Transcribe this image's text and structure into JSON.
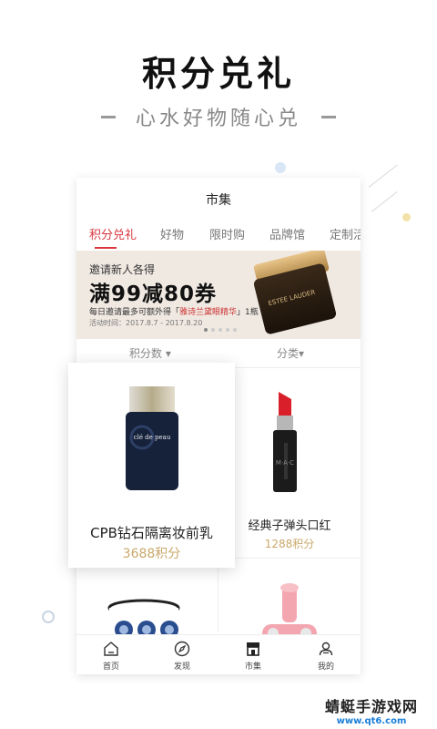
{
  "hero": {
    "title": "积分兑礼",
    "subtitle": "心水好物随心兑"
  },
  "app": {
    "page_title": "市集",
    "tabs": [
      {
        "label": "积分兑礼",
        "active": true
      },
      {
        "label": "好物"
      },
      {
        "label": "限时购"
      },
      {
        "label": "品牌馆"
      },
      {
        "label": "定制活"
      }
    ],
    "banner": {
      "line1": "邀请新人各得",
      "line2": "满99减80券",
      "line3_prefix": "每日邀请最多可额外得「",
      "line3_highlight": "雅诗兰黛眼精华",
      "line3_suffix": "」1瓶",
      "line4": "活动时间：2017.8.7 - 2017.8.20",
      "product_label": "ESTEE LAUDER",
      "page_dots": 5,
      "active_dot": 0
    },
    "filters": {
      "points": "积分数",
      "category": "分类"
    },
    "products": [
      {
        "name": "CPB钻石隔离妆前乳",
        "points": "3688积分",
        "image": "cpb-primer-bottle",
        "bottle_text": "clé de peau"
      },
      {
        "name": "经典子弹头口红",
        "points": "1288积分",
        "image": "mac-lipstick"
      },
      {
        "name": "",
        "points": "",
        "image": "blue-pattern-cup"
      },
      {
        "name": "",
        "points": "",
        "image": "pink-toy"
      }
    ],
    "bottom_nav": [
      {
        "label": "首页",
        "icon": "home-icon"
      },
      {
        "label": "发现",
        "icon": "compass-icon"
      },
      {
        "label": "市集",
        "icon": "store-icon",
        "active": true
      },
      {
        "label": "我的",
        "icon": "user-icon"
      }
    ]
  },
  "watermark": {
    "line1": "蜻蜓手游戏网",
    "line2": "www.qt6.com"
  },
  "colors": {
    "accent": "#d9363e",
    "points_gold": "#c9a86a",
    "dot_blue": "#c9dcf2",
    "dot_yellow": "#f3e2a8"
  }
}
